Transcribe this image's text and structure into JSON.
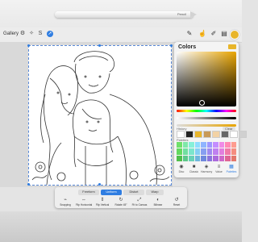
{
  "pencil": {
    "brand": "Pencil"
  },
  "toolbar": {
    "gallery_label": "Gallery",
    "left_tools": [
      "wrench-icon",
      "magic-wand-icon",
      "selection-icon"
    ],
    "right_tools": [
      "brush-icon",
      "smudge-icon",
      "eraser-icon",
      "layers-icon"
    ],
    "current_color": "#e8b52a"
  },
  "colors_panel": {
    "title": "Colors",
    "current_color": "#e8b52a",
    "history_label": "History",
    "clear_label": "Clear",
    "history_colors": [
      "#ffffff",
      "#222222",
      "#e8b52a",
      "#c89a58",
      "#f2d2a5",
      "#666666",
      "#ffffff",
      "#d0d0d0"
    ],
    "palette_label": "Palettes",
    "palette_colors": [
      "#6fe06a",
      "#7fe8a9",
      "#86f0d9",
      "#8edcff",
      "#8fb4ff",
      "#9d97ff",
      "#c38dff",
      "#f08be7",
      "#ff8ab5",
      "#ff9c8f",
      "#63d960",
      "#70dfa0",
      "#7ce6cc",
      "#85cff4",
      "#879ef0",
      "#9f8af0",
      "#bf80f0",
      "#e17fde",
      "#f07aa8",
      "#f58d80",
      "#4fbf4c",
      "#5cc88b",
      "#69d2b8",
      "#6fb6dd",
      "#6f88dd",
      "#8a74dd",
      "#ab6adc",
      "#cd68c9",
      "#df6594",
      "#e4776b"
    ],
    "tabs": [
      {
        "icon": "disc-icon",
        "label": "Disc"
      },
      {
        "icon": "classic-icon",
        "label": "Classic"
      },
      {
        "icon": "harmony-icon",
        "label": "Harmony"
      },
      {
        "icon": "value-icon",
        "label": "Value"
      },
      {
        "icon": "palettes-icon",
        "label": "Palettes"
      }
    ]
  },
  "selection_bar": {
    "modes": [
      {
        "label": "Freeform",
        "active": false
      },
      {
        "label": "Uniform",
        "active": true
      },
      {
        "label": "Distort",
        "active": false
      },
      {
        "label": "Warp",
        "active": false
      }
    ],
    "actions": [
      {
        "icon": "snapping-icon",
        "label": "Snapping"
      },
      {
        "icon": "flip-horizontal-icon",
        "label": "Flip Horizontal"
      },
      {
        "icon": "flip-vertical-icon",
        "label": "Flip Vertical"
      },
      {
        "icon": "rotate-icon",
        "label": "Rotate 45°"
      },
      {
        "icon": "fit-to-canvas-icon",
        "label": "Fit to Canvas"
      },
      {
        "icon": "interpolation-icon",
        "label": "Bilinear"
      },
      {
        "icon": "reset-icon",
        "label": "Reset"
      }
    ]
  }
}
